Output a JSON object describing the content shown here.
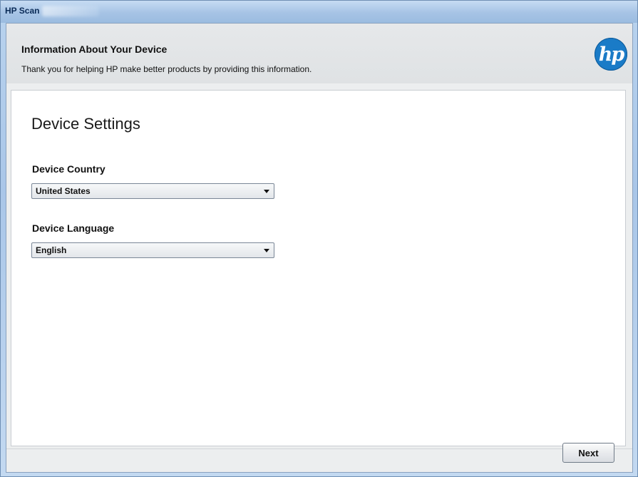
{
  "window": {
    "title": "HP Scan"
  },
  "header": {
    "title": "Information About Your Device",
    "subtitle": "Thank you for helping HP make better products by providing this information.",
    "logo_text": "hp",
    "logo_color": "#1a7bc7"
  },
  "main": {
    "section_title": "Device Settings",
    "country": {
      "label": "Device Country",
      "value": "United States"
    },
    "language": {
      "label": "Device Language",
      "value": "English"
    }
  },
  "footer": {
    "next_label": "Next"
  }
}
